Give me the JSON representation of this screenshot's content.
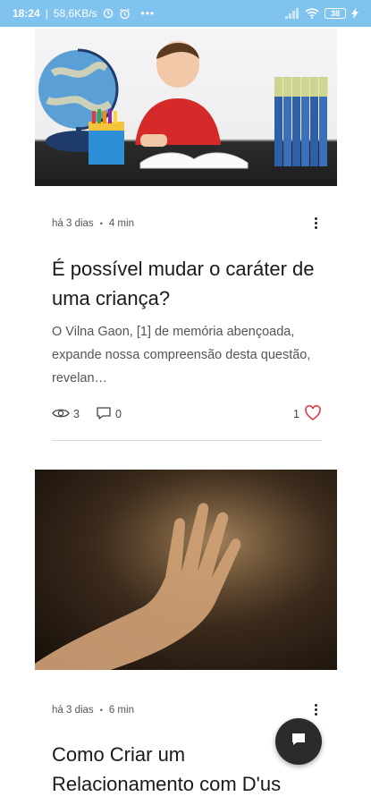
{
  "status_bar": {
    "time": "18:24",
    "network_speed": "58,6KB/s",
    "battery": "38"
  },
  "posts": [
    {
      "image_icon": "boy-reading-photo",
      "date": "há 3 dias",
      "read_time": "4 min",
      "title": "É possível mudar o caráter de uma criança?",
      "excerpt": "O Vilna Gaon, [1] de memória abençoada, expande nossa compreensão desta questão, revelan…",
      "views": "3",
      "comments": "0",
      "likes": "1"
    },
    {
      "image_icon": "hand-in-light-photo",
      "date": "há 3 dias",
      "read_time": "6 min",
      "title": "Como Criar um Relacionamento com D'us"
    }
  ],
  "colors": {
    "status_bar": "#7fc3ee",
    "heart": "#e0394a",
    "fab": "#2b2b2b"
  }
}
